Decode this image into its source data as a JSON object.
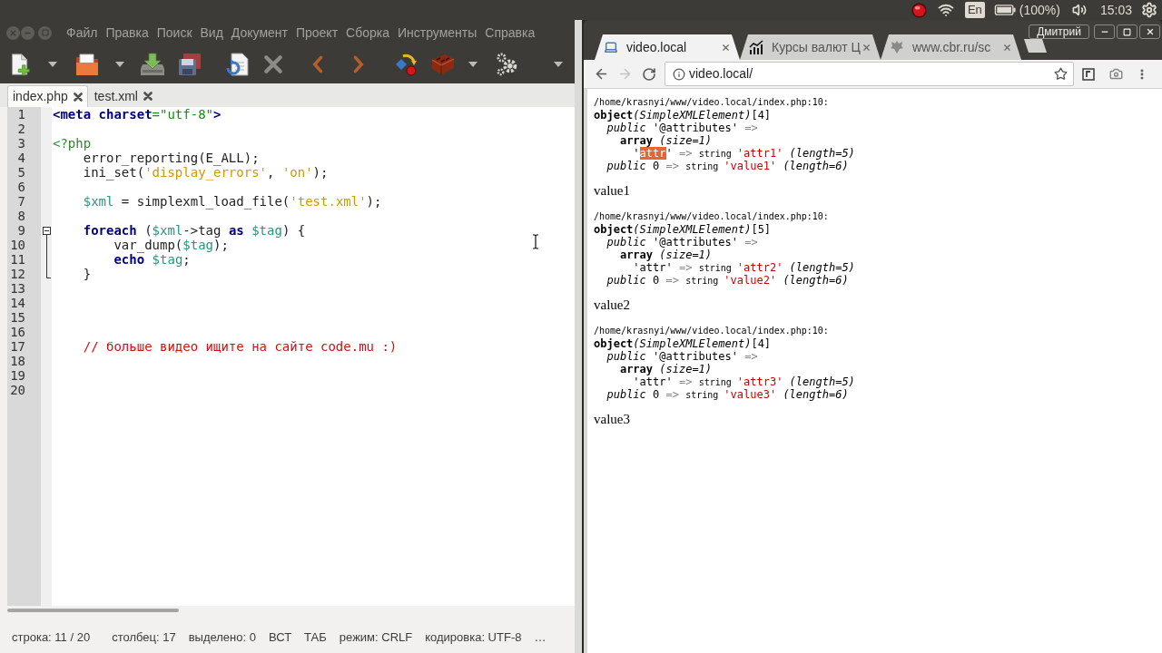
{
  "top_panel": {
    "keyboard_layout": "En",
    "battery": "(100%)",
    "clock": "15:03"
  },
  "editor_window": {
    "menu": [
      "Файл",
      "Правка",
      "Поиск",
      "Вид",
      "Документ",
      "Проект",
      "Сборка",
      "Инструменты",
      "Справка"
    ],
    "tabs": [
      {
        "label": "index.php",
        "selected": true
      },
      {
        "label": "test.xml",
        "selected": false
      }
    ],
    "lines": [
      {
        "number": "1",
        "tokens": [
          {
            "kind": "markup",
            "text": "<meta charset"
          },
          {
            "kind": "markup_value",
            "text": "=\"utf-8\""
          },
          {
            "kind": "markup",
            "text": ">"
          }
        ]
      },
      {
        "number": "2"
      },
      {
        "number": "3",
        "tokens": [
          {
            "kind": "php_tag",
            "text": "<?php"
          }
        ]
      },
      {
        "number": "4",
        "tokens": [
          {
            "kind": "plain",
            "text": "    error_reporting(E_ALL);"
          }
        ]
      },
      {
        "number": "5",
        "tokens": [
          {
            "kind": "plain",
            "text": "    ini_set("
          },
          {
            "kind": "string",
            "text": "'display_errors'"
          },
          {
            "kind": "plain",
            "text": ", "
          },
          {
            "kind": "string",
            "text": "'on'"
          },
          {
            "kind": "plain",
            "text": ");"
          }
        ]
      },
      {
        "number": "6"
      },
      {
        "number": "7",
        "tokens": [
          {
            "kind": "variable",
            "text": "    $xml"
          },
          {
            "kind": "plain",
            "text": " = simplexml_load_file("
          },
          {
            "kind": "string",
            "text": "'test.xml'"
          },
          {
            "kind": "plain",
            "text": ");"
          }
        ]
      },
      {
        "number": "8"
      },
      {
        "number": "9",
        "fold_expanded": true,
        "tokens": [
          {
            "kind": "keyword",
            "text": "    foreach"
          },
          {
            "kind": "plain",
            "text": " ("
          },
          {
            "kind": "variable",
            "text": "$xml"
          },
          {
            "kind": "plain",
            "text": "->tag "
          },
          {
            "kind": "keyword",
            "text": "as "
          },
          {
            "kind": "variable",
            "text": "$tag"
          },
          {
            "kind": "plain",
            "text": ") {"
          }
        ]
      },
      {
        "number": "10",
        "tokens": [
          {
            "kind": "plain",
            "text": "        var_dump("
          },
          {
            "kind": "variable",
            "text": "$tag"
          },
          {
            "kind": "plain",
            "text": ");"
          }
        ]
      },
      {
        "number": "11",
        "tokens": [
          {
            "kind": "keyword",
            "text": "        echo "
          },
          {
            "kind": "variable",
            "text": "$tag"
          },
          {
            "kind": "plain",
            "text": ";"
          }
        ]
      },
      {
        "number": "12",
        "tokens": [
          {
            "kind": "plain",
            "text": "    }"
          }
        ]
      },
      {
        "number": "13"
      },
      {
        "number": "14"
      },
      {
        "number": "15"
      },
      {
        "number": "16"
      },
      {
        "number": "17",
        "tokens": [
          {
            "kind": "comment",
            "text": "    // больше видео ищите на сайте code.mu :)"
          }
        ]
      },
      {
        "number": "18"
      },
      {
        "number": "19"
      },
      {
        "number": "20"
      }
    ],
    "status_bar": [
      "строка: 11 / 20",
      "столбец: 17",
      "выделено: 0",
      "ВСТ",
      "ТАБ",
      "режим: CRLF",
      "кодировка: UTF-8",
      "…"
    ]
  },
  "browser_window": {
    "profile": "Дмитрий",
    "tabs": [
      {
        "title": "video.local",
        "selected": true
      },
      {
        "title": "Курсы валют Ц",
        "selected": false
      },
      {
        "title": "www.cbr.ru/sc",
        "selected": false
      }
    ],
    "back": {
      "disabled": false
    },
    "forward": {
      "disabled": true
    },
    "address": "video.local/",
    "dumps": [
      {
        "location": "/home/krasnyi/www/video.local/index.php:10:",
        "lines": [
          [
            {
              "kind": "bold",
              "text": "object"
            },
            {
              "kind": "italic",
              "text": "(SimpleXMLElement)"
            },
            {
              "kind": "plain",
              "text": "[4]"
            }
          ],
          [
            {
              "kind": "italic",
              "text": "  public"
            },
            {
              "kind": "plain",
              "text": " '@attributes' "
            },
            {
              "kind": "arrow",
              "text": "=>"
            }
          ],
          [
            {
              "kind": "bold",
              "text": "    array "
            },
            {
              "kind": "italic",
              "text": "(size=1)"
            }
          ],
          [
            {
              "kind": "plain",
              "text": "      '"
            },
            {
              "kind": "match",
              "text": "attr"
            },
            {
              "kind": "plain",
              "text": "' "
            },
            {
              "kind": "arrow",
              "text": "=> "
            },
            {
              "kind": "small",
              "text": "string "
            },
            {
              "kind": "string",
              "text": "'attr1' "
            },
            {
              "kind": "italic",
              "text": "(length=5)"
            }
          ],
          [
            {
              "kind": "italic",
              "text": "  public"
            },
            {
              "kind": "plain",
              "text": " 0 "
            },
            {
              "kind": "arrow",
              "text": "=> "
            },
            {
              "kind": "small",
              "text": "string "
            },
            {
              "kind": "string",
              "text": "'value1' "
            },
            {
              "kind": "italic",
              "text": "(length=6)"
            }
          ]
        ],
        "output": "value1"
      },
      {
        "location": "/home/krasnyi/www/video.local/index.php:10:",
        "lines": [
          [
            {
              "kind": "bold",
              "text": "object"
            },
            {
              "kind": "italic",
              "text": "(SimpleXMLElement)"
            },
            {
              "kind": "plain",
              "text": "[5]"
            }
          ],
          [
            {
              "kind": "italic",
              "text": "  public"
            },
            {
              "kind": "plain",
              "text": " '@attributes' "
            },
            {
              "kind": "arrow",
              "text": "=>"
            }
          ],
          [
            {
              "kind": "bold",
              "text": "    array "
            },
            {
              "kind": "italic",
              "text": "(size=1)"
            }
          ],
          [
            {
              "kind": "plain",
              "text": "      'attr' "
            },
            {
              "kind": "arrow",
              "text": "=> "
            },
            {
              "kind": "small",
              "text": "string "
            },
            {
              "kind": "string",
              "text": "'attr2' "
            },
            {
              "kind": "italic",
              "text": "(length=5)"
            }
          ],
          [
            {
              "kind": "italic",
              "text": "  public"
            },
            {
              "kind": "plain",
              "text": " 0 "
            },
            {
              "kind": "arrow",
              "text": "=> "
            },
            {
              "kind": "small",
              "text": "string "
            },
            {
              "kind": "string",
              "text": "'value2' "
            },
            {
              "kind": "italic",
              "text": "(length=6)"
            }
          ]
        ],
        "output": "value2"
      },
      {
        "location": "/home/krasnyi/www/video.local/index.php:10:",
        "lines": [
          [
            {
              "kind": "bold",
              "text": "object"
            },
            {
              "kind": "italic",
              "text": "(SimpleXMLElement)"
            },
            {
              "kind": "plain",
              "text": "[4]"
            }
          ],
          [
            {
              "kind": "italic",
              "text": "  public"
            },
            {
              "kind": "plain",
              "text": " '@attributes' "
            },
            {
              "kind": "arrow",
              "text": "=>"
            }
          ],
          [
            {
              "kind": "bold",
              "text": "    array "
            },
            {
              "kind": "italic",
              "text": "(size=1)"
            }
          ],
          [
            {
              "kind": "plain",
              "text": "      'attr' "
            },
            {
              "kind": "arrow",
              "text": "=> "
            },
            {
              "kind": "small",
              "text": "string "
            },
            {
              "kind": "string",
              "text": "'attr3' "
            },
            {
              "kind": "italic",
              "text": "(length=5)"
            }
          ],
          [
            {
              "kind": "italic",
              "text": "  public"
            },
            {
              "kind": "plain",
              "text": " 0 "
            },
            {
              "kind": "arrow",
              "text": "=> "
            },
            {
              "kind": "small",
              "text": "string "
            },
            {
              "kind": "string",
              "text": "'value3' "
            },
            {
              "kind": "italic",
              "text": "(length=6)"
            }
          ]
        ],
        "output": "value3"
      }
    ]
  }
}
